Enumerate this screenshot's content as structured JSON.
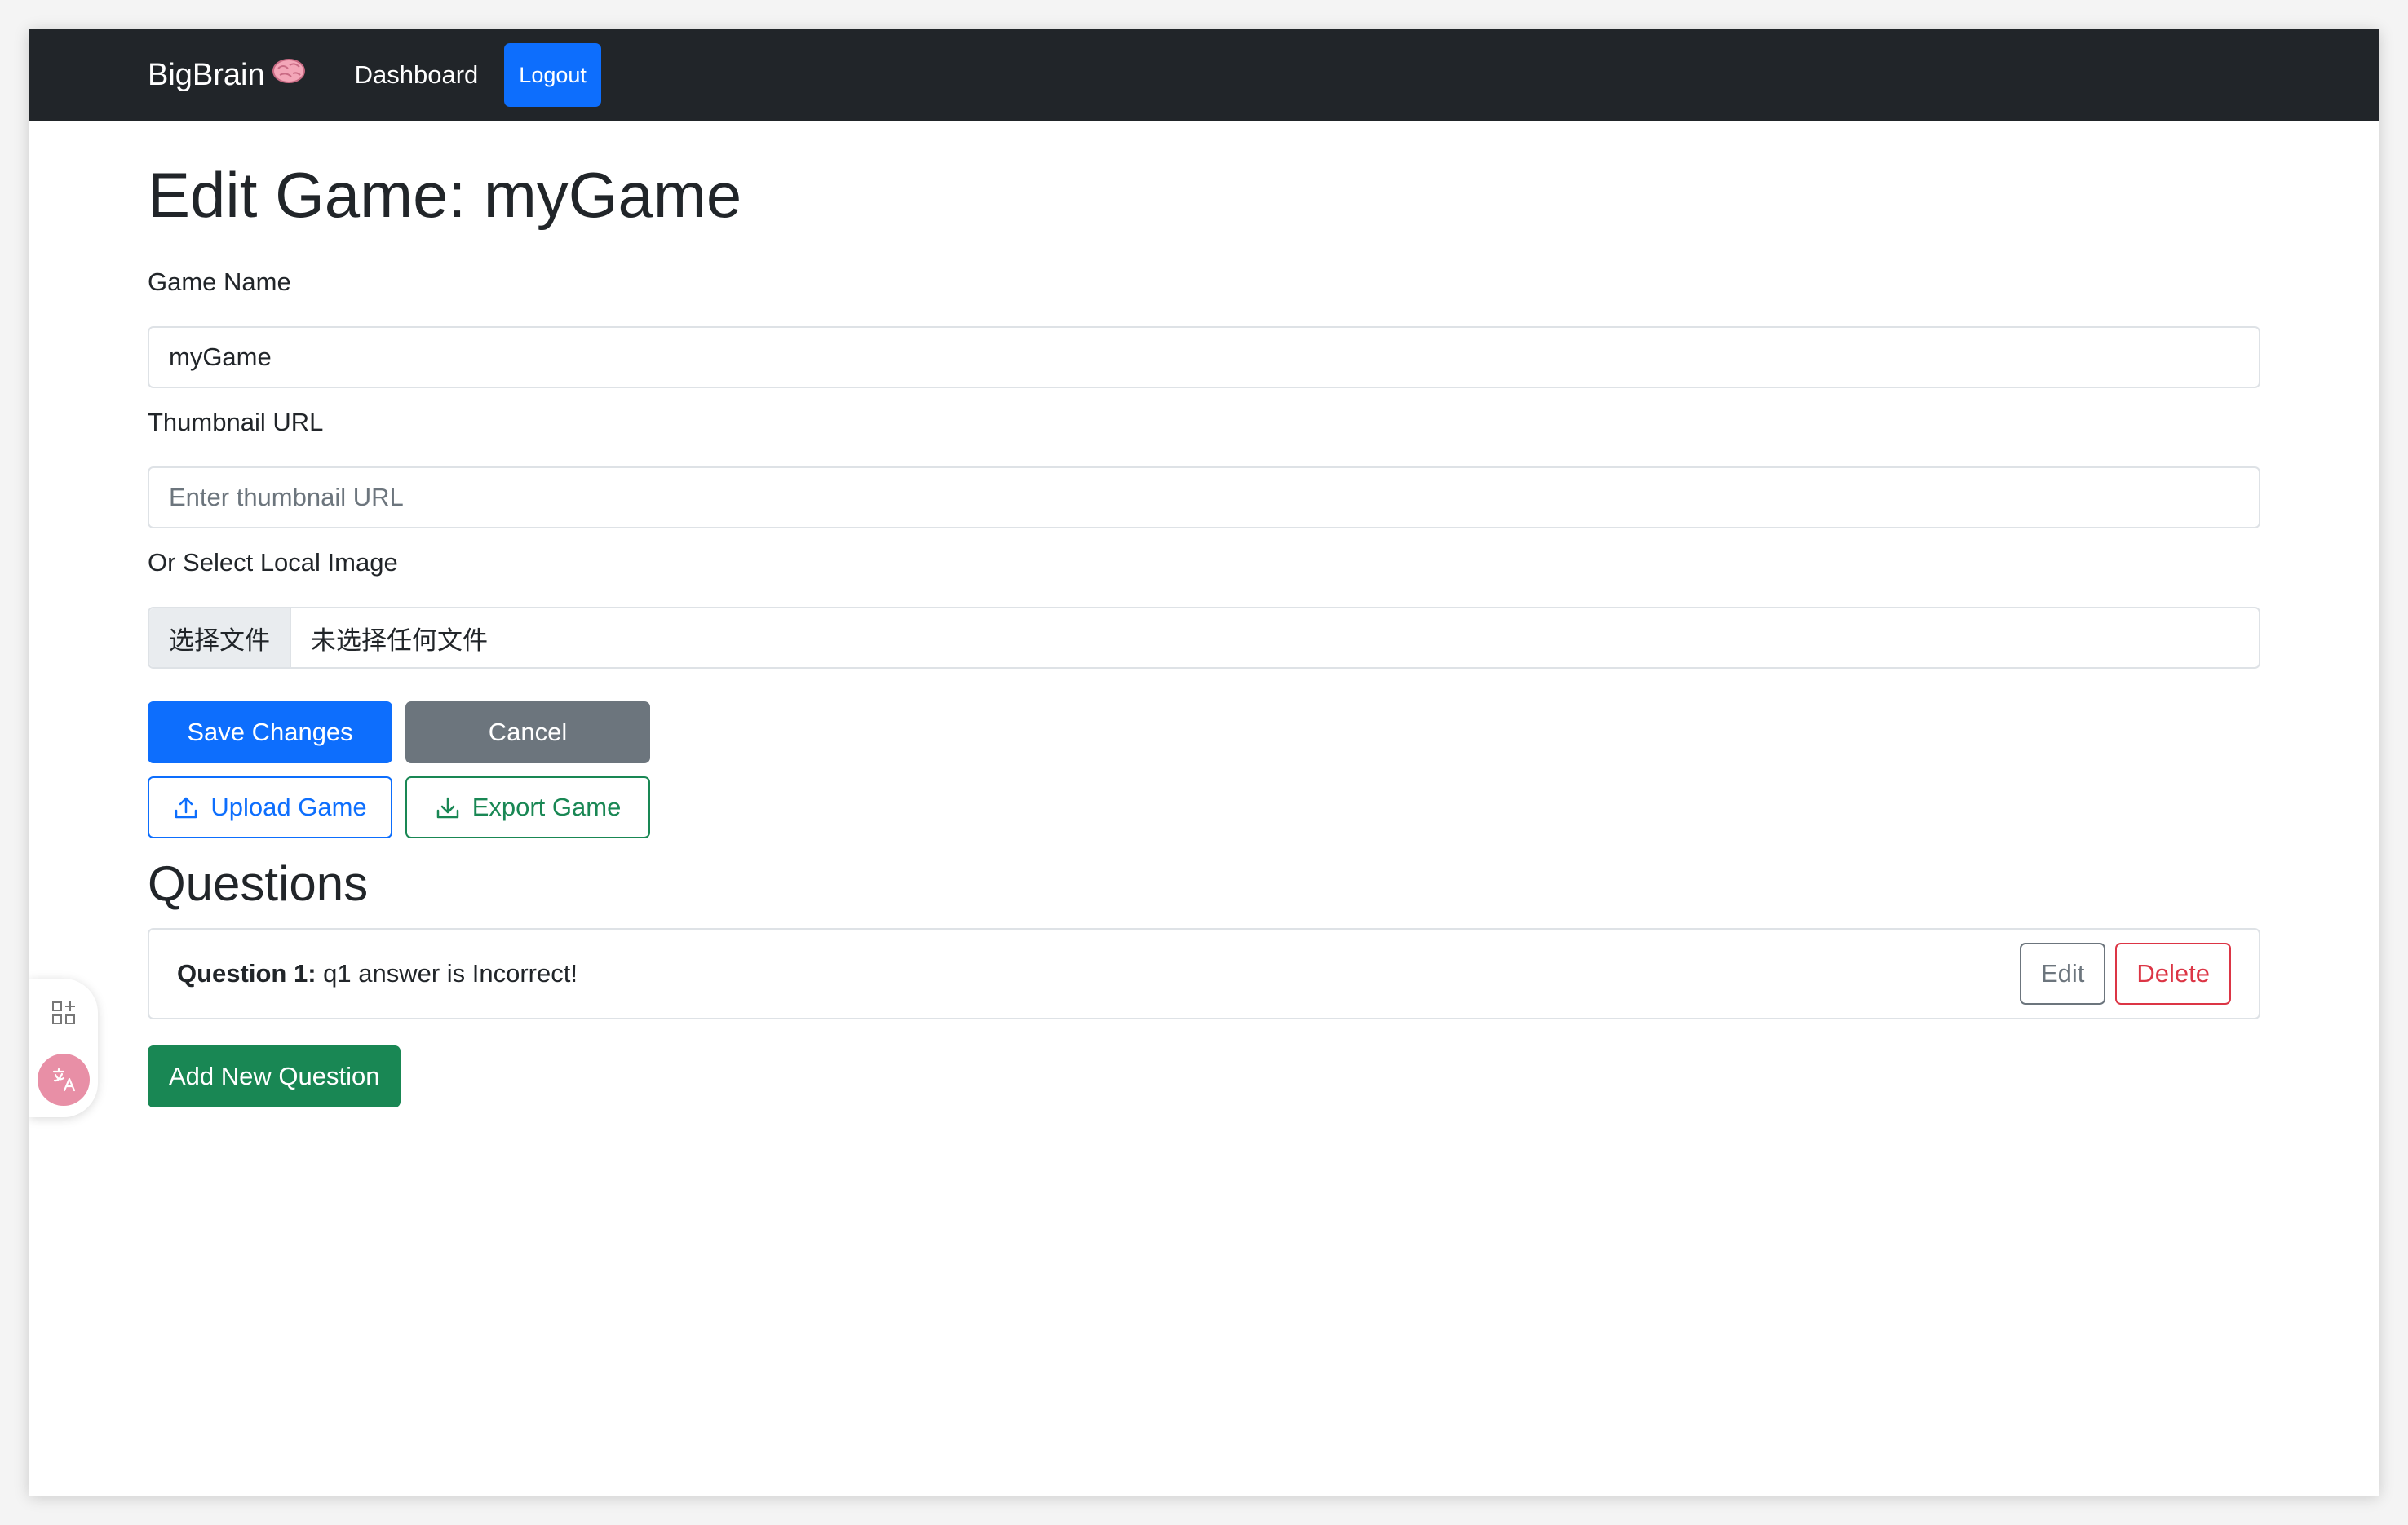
{
  "navbar": {
    "brand": "BigBrain",
    "brand_emoji": "🧠",
    "dashboard_label": "Dashboard",
    "logout_label": "Logout"
  },
  "page": {
    "title": "Edit Game: myGame"
  },
  "form": {
    "game_name_label": "Game Name",
    "game_name_value": "myGame",
    "thumbnail_label": "Thumbnail URL",
    "thumbnail_placeholder": "Enter thumbnail URL",
    "local_image_label": "Or Select Local Image",
    "file_button_label": "选择文件",
    "file_status": "未选择任何文件"
  },
  "actions": {
    "save_label": "Save Changes",
    "cancel_label": "Cancel",
    "upload_label": "Upload Game",
    "export_label": "Export Game"
  },
  "questions": {
    "heading": "Questions",
    "items": [
      {
        "title": "Question 1:",
        "text": " q1 answer is Incorrect!",
        "edit_label": "Edit",
        "delete_label": "Delete"
      }
    ],
    "add_label": "Add New Question"
  },
  "colors": {
    "navbar": "#212529",
    "primary": "#0d6efd",
    "secondary": "#6c757d",
    "success": "#198754",
    "danger": "#dc3545"
  }
}
